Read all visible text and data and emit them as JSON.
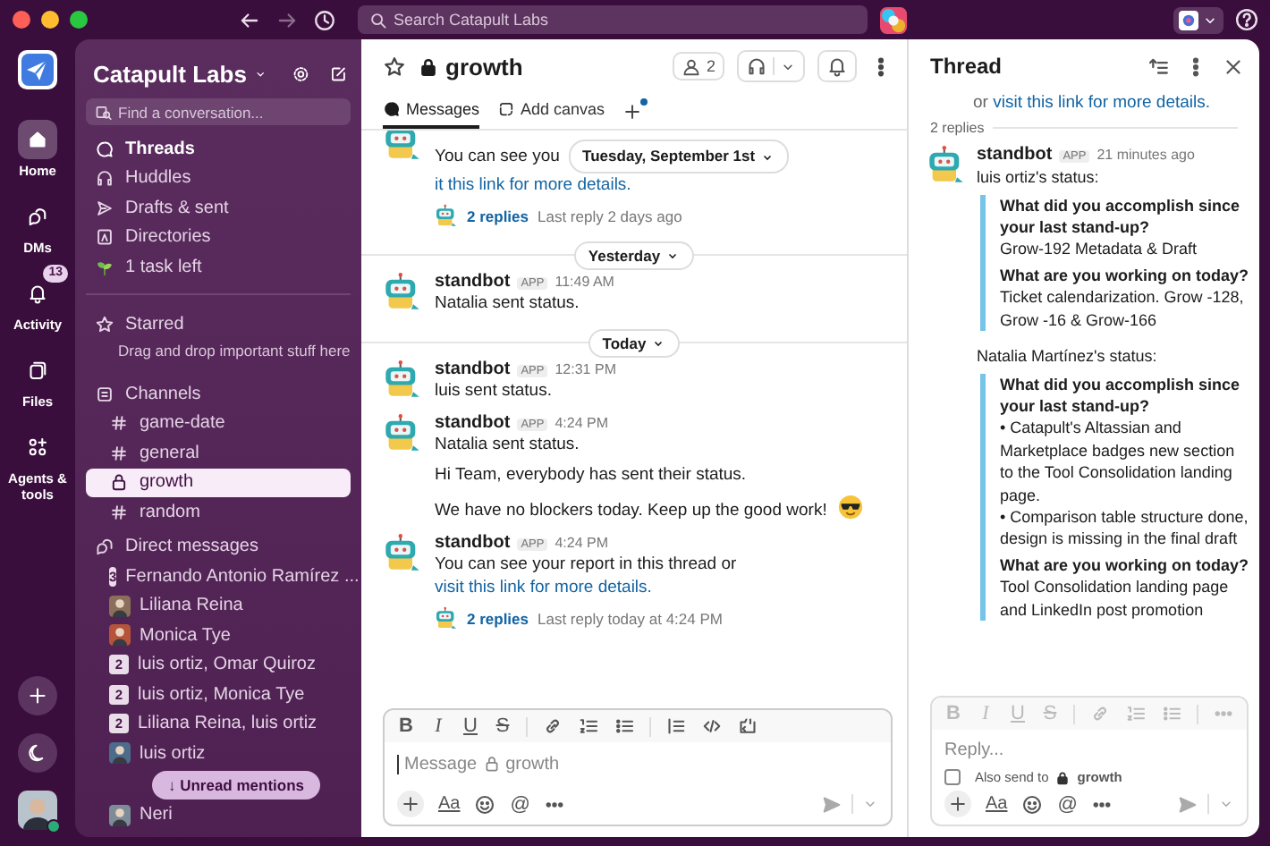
{
  "titlebar": {
    "search_placeholder": "Search Catapult Labs"
  },
  "rail": {
    "items": [
      {
        "label": "Home",
        "kind": "home",
        "selected": true
      },
      {
        "label": "DMs",
        "kind": "dms",
        "selected": false
      },
      {
        "label": "Activity",
        "kind": "bell",
        "selected": false,
        "badge": "13"
      },
      {
        "label": "Files",
        "kind": "files",
        "selected": false
      },
      {
        "label": "Agents & tools",
        "kind": "agents",
        "selected": false
      }
    ]
  },
  "sidebar": {
    "workspace": "Catapult Labs",
    "search_placeholder": "Find a conversation...",
    "nav": [
      {
        "label": "Threads",
        "kind": "threads",
        "unread": true
      },
      {
        "label": "Huddles",
        "kind": "headphones",
        "unread": false
      },
      {
        "label": "Drafts & sent",
        "kind": "send",
        "unread": false
      },
      {
        "label": "Directories",
        "kind": "directory",
        "unread": false
      },
      {
        "label": "1 task left",
        "kind": "sprout",
        "unread": false
      }
    ],
    "starred": {
      "title": "Starred",
      "hint": "Drag and drop important stuff here"
    },
    "channels": {
      "title": "Channels",
      "items": [
        {
          "name": "game-date",
          "private": false,
          "selected": false
        },
        {
          "name": "general",
          "private": false,
          "selected": false
        },
        {
          "name": "growth",
          "private": true,
          "selected": true
        },
        {
          "name": "random",
          "private": false,
          "selected": false
        }
      ]
    },
    "direct_messages": {
      "title": "Direct messages",
      "items": [
        {
          "name": "Fernando Antonio Ramírez ...",
          "kind": "group",
          "count": "3"
        },
        {
          "name": "Liliana Reina",
          "kind": "person",
          "color": "#8a6f5a"
        },
        {
          "name": "Monica Tye",
          "kind": "person",
          "color": "#b5543a"
        },
        {
          "name": "luis ortiz, Omar Quiroz",
          "kind": "group",
          "count": "2"
        },
        {
          "name": "luis ortiz, Monica Tye",
          "kind": "group",
          "count": "2"
        },
        {
          "name": "Liliana Reina, luis ortiz",
          "kind": "group",
          "count": "2"
        },
        {
          "name": "luis ortiz",
          "kind": "person",
          "color": "#4d6b8a"
        }
      ]
    },
    "unread_button": "↓ Unread mentions",
    "last_dm": {
      "name": "Neri",
      "kind": "person",
      "color": "#7d8c99"
    }
  },
  "channel": {
    "name": "growth",
    "private": true,
    "members": "2",
    "tabs": [
      {
        "label": "Messages",
        "kind": "messages",
        "selected": true
      },
      {
        "label": "Add canvas",
        "kind": "canvas",
        "selected": false
      }
    ],
    "messages": [
      {
        "kind": "cut_message",
        "lines": [
          [
            {
              "kind": "text",
              "text": "You can see you"
            },
            {
              "kind": "date_pill",
              "text": "Tuesday, September 1st"
            },
            {
              "kind": "link",
              "text": "it this link for more"
            },
            {
              "kind": "link",
              "text": "details."
            }
          ]
        ],
        "replies": {
          "count": "2 replies",
          "last": "Last reply 2 days ago"
        }
      },
      {
        "kind": "day",
        "label": "Yesterday"
      },
      {
        "kind": "message",
        "author": "standbot",
        "badge": "APP",
        "time": "11:49 AM",
        "lines": [
          [
            {
              "kind": "text",
              "text": "Natalia sent status."
            }
          ]
        ]
      },
      {
        "kind": "day",
        "label": "Today"
      },
      {
        "kind": "message",
        "author": "standbot",
        "badge": "APP",
        "time": "12:31 PM",
        "lines": [
          [
            {
              "kind": "text",
              "text": "luis sent status."
            }
          ]
        ]
      },
      {
        "kind": "message",
        "author": "standbot",
        "badge": "APP",
        "time": "4:24 PM",
        "lines": [
          [
            {
              "kind": "text",
              "text": "Natalia sent status."
            }
          ],
          [
            {
              "kind": "text",
              "text": "Hi Team, everybody has sent their status."
            }
          ],
          [
            {
              "kind": "text",
              "text": "We have no blockers today. Keep up the good work!"
            },
            {
              "kind": "emoji"
            }
          ]
        ]
      },
      {
        "kind": "message",
        "author": "standbot",
        "badge": "APP",
        "time": "4:24 PM",
        "lines": [
          [
            {
              "kind": "text",
              "text": "You can see your report in this thread or"
            },
            {
              "kind": "link",
              "text": "visit this link for more"
            },
            {
              "kind": "link",
              "text": "details."
            }
          ]
        ],
        "replies": {
          "count": "2 replies",
          "last": "Last reply today at 4:24 PM"
        }
      }
    ],
    "composer": {
      "disabled": false,
      "placeholder": "Message",
      "channel": "growth",
      "toolbar": [
        {
          "kind": "bold",
          "glyph": "B"
        },
        {
          "kind": "italic",
          "glyph": "I"
        },
        {
          "kind": "underline",
          "glyph": "U"
        },
        {
          "kind": "strike",
          "glyph": "S"
        },
        {
          "kind": "sep"
        },
        {
          "kind": "link"
        },
        {
          "kind": "ordered"
        },
        {
          "kind": "bullets"
        },
        {
          "kind": "sep"
        },
        {
          "kind": "quote"
        },
        {
          "kind": "code"
        },
        {
          "kind": "codeblock"
        }
      ],
      "actions": [
        {
          "kind": "plus"
        },
        {
          "kind": "format",
          "glyph": "Aa"
        },
        {
          "kind": "emoji"
        },
        {
          "kind": "mention",
          "glyph": "@"
        },
        {
          "kind": "more"
        }
      ]
    }
  },
  "thread": {
    "title": "Thread",
    "above_prefix": "or",
    "above_link": "visit this link for more details.",
    "replies_label": "2 replies",
    "message": {
      "author": "standbot",
      "badge": "APP",
      "time": "21 minutes ago",
      "blocks": [
        {
          "kind": "text",
          "text": "luis ortiz's status:"
        },
        {
          "kind": "quote",
          "items": [
            {
              "kind": "question",
              "text": "What did you accomplish since your last stand-up?"
            },
            {
              "kind": "answer",
              "text": "Grow-192 Metadata & Draft"
            },
            {
              "kind": "question",
              "text": "What are you working on today?"
            },
            {
              "kind": "answer",
              "text": "Ticket calendarization. Grow -128, Grow -16 & Grow-166"
            }
          ]
        },
        {
          "kind": "text",
          "text": "Natalia Martínez's status:"
        },
        {
          "kind": "quote",
          "items": [
            {
              "kind": "question",
              "text": "What did you accomplish since your last stand-up?"
            },
            {
              "kind": "answer",
              "text": "• Catapult's Altassian and Marketplace badges new section to the Tool Consolidation landing page."
            },
            {
              "kind": "answer",
              "text": "• Comparison table structure done, design is missing in the final draft"
            },
            {
              "kind": "question",
              "text": "What are you working on today?"
            },
            {
              "kind": "answer",
              "text": "Tool Consolidation landing page and LinkedIn post promotion"
            }
          ]
        }
      ]
    },
    "composer": {
      "disabled": true,
      "placeholder": "Reply...",
      "also_send": {
        "label": "Also send to",
        "channel": "growth",
        "checked": false
      },
      "toolbar": [
        {
          "kind": "bold",
          "glyph": "B"
        },
        {
          "kind": "italic",
          "glyph": "I"
        },
        {
          "kind": "underline",
          "glyph": "U"
        },
        {
          "kind": "strike",
          "glyph": "S"
        },
        {
          "kind": "sep"
        },
        {
          "kind": "link"
        },
        {
          "kind": "ordered"
        },
        {
          "kind": "bullets"
        },
        {
          "kind": "sep"
        },
        {
          "kind": "more"
        }
      ],
      "actions": [
        {
          "kind": "plus"
        },
        {
          "kind": "format",
          "glyph": "Aa"
        },
        {
          "kind": "emoji"
        },
        {
          "kind": "mention",
          "glyph": "@"
        },
        {
          "kind": "more"
        }
      ]
    }
  }
}
